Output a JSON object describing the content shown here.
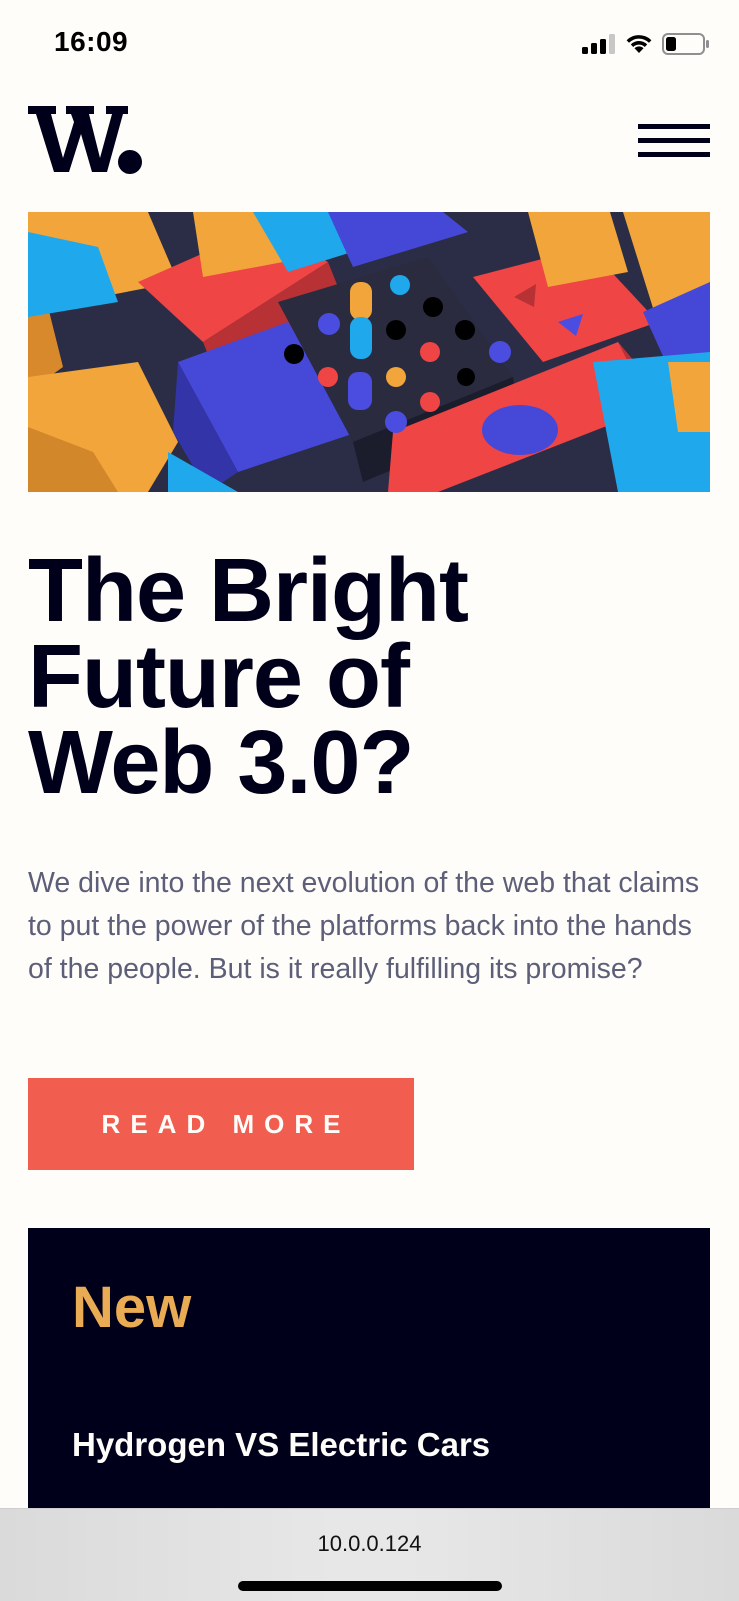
{
  "status_bar": {
    "time": "16:09",
    "icons": [
      "cellular-signal-icon",
      "wifi-icon",
      "battery-icon"
    ]
  },
  "header": {
    "logo": "W.",
    "menu_icon": "hamburger-menu-icon"
  },
  "hero": {
    "image": "abstract colorful 3D blocks illustration",
    "headline_lines": [
      "The Bright",
      "Future of",
      "Web 3.0?"
    ],
    "description": "We dive into the next evolution of the web that claims to put the power of the platforms back into the hands of the people. But is it really fulfilling its promise?",
    "cta_label": "READ MORE"
  },
  "new_panel": {
    "title": "New",
    "first_article_title": "Hydrogen VS Electric Cars"
  },
  "browser": {
    "url": "10.0.0.124"
  },
  "colors": {
    "background": "#fffdfa",
    "text_dark": "#00001a",
    "text_muted": "#5d5f79",
    "accent_red": "#f15e50",
    "accent_orange": "#e9ab53",
    "panel_dark": "#00001a"
  }
}
